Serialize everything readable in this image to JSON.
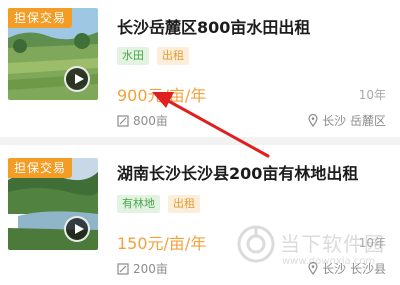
{
  "listings": [
    {
      "badge": "担保交易",
      "title": "长沙岳麓区800亩水田出租",
      "tags": [
        "水田",
        "出租"
      ],
      "price": "900元/亩/年",
      "years": "10年",
      "area": "800亩",
      "location": "长沙 岳麓区"
    },
    {
      "badge": "担保交易",
      "title": "湖南长沙长沙县200亩有林地出租",
      "tags": [
        "有林地",
        "出租"
      ],
      "price": "150元/亩/年",
      "years": "10年",
      "area": "200亩",
      "location": "长沙 长沙县"
    }
  ],
  "watermark": {
    "text": "当下软件园",
    "url": "www.downxia.com"
  },
  "colors": {
    "accent_orange": "#f5a13a",
    "badge_orange": "#f39c26",
    "tag_green": "#4aa64a",
    "arrow_red": "#e02020"
  }
}
